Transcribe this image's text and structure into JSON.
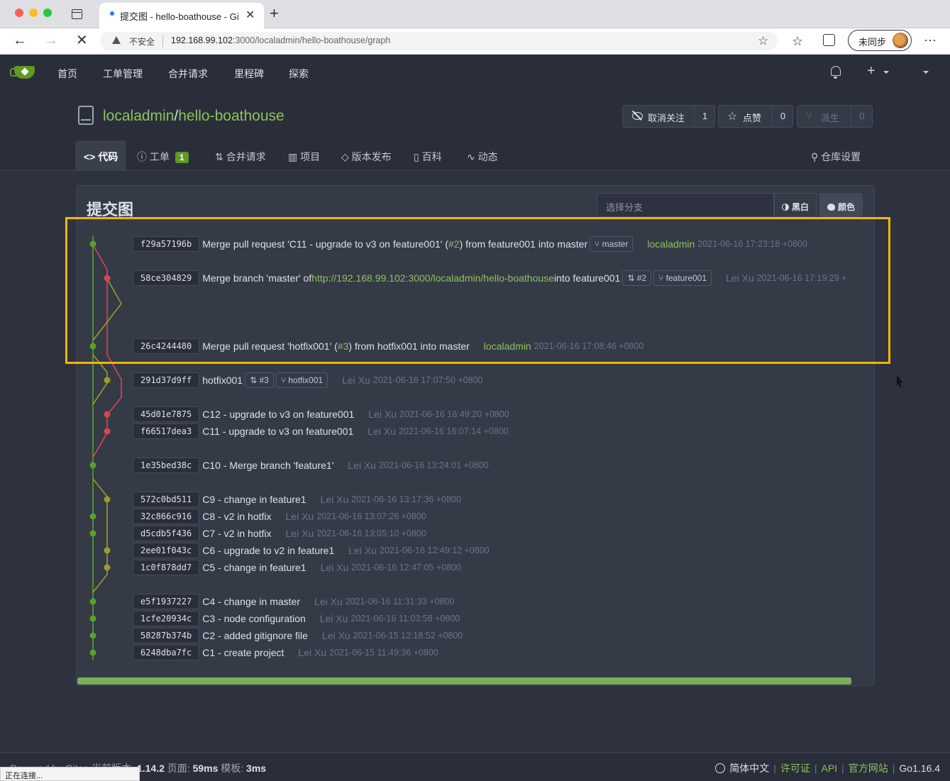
{
  "browser": {
    "tab_title": "提交图 - hello-boathouse - Gitea",
    "insecure_label": "不安全",
    "url_host": "192.168.99.102",
    "url_rest": ":3000/localadmin/hello-boathouse/graph",
    "profile_label": "未同步",
    "status_text": "正在连接..."
  },
  "nav": {
    "items": [
      "首页",
      "工单管理",
      "合并请求",
      "里程碑",
      "探索"
    ]
  },
  "repo": {
    "owner": "localadmin",
    "separator": "/",
    "name": "hello-boathouse",
    "watch_label": "取消关注",
    "watch_count": "1",
    "star_label": "点赞",
    "star_count": "0",
    "fork_label": "派生",
    "fork_count": "0",
    "tabs": {
      "code": "代码",
      "issues": "工单",
      "issues_count": "1",
      "pulls": "合并请求",
      "projects": "项目",
      "releases": "版本发布",
      "wiki": "百科",
      "activity": "动态",
      "settings": "仓库设置"
    }
  },
  "graph": {
    "title": "提交图",
    "branch_placeholder": "选择分支",
    "mode_mono": "黑白",
    "mode_color": "颜色",
    "commits": [
      {
        "sha": "f29a57196b",
        "message": "Merge pull request 'C11 - upgrade to v3 on feature001' (",
        "link": "#2",
        "message_tail": ") from feature001 into master",
        "refs": [
          "master"
        ],
        "author": "localadmin",
        "date": "2021-06-16 17:23:18 +0800"
      },
      {
        "sha": "58ce304829",
        "message": "Merge branch 'master' of",
        "link": "http://192.168.99.102:3000/localadmin/hello-boathouse",
        "message_tail": "into feature001",
        "refs": [
          "#2",
          "feature001"
        ],
        "author": "Lei Xu",
        "date": "2021-06-16 17:19:29 +"
      },
      {
        "sha": "26c4244480",
        "message": "Merge pull request 'hotfix001' (",
        "link": "#3",
        "message_tail": ") from hotfix001 into master",
        "refs": [],
        "author": "localadmin",
        "date": "2021-06-16 17:08:46 +0800"
      },
      {
        "sha": "291d37d9ff",
        "message": "hotfix001",
        "refs": [
          "#3",
          "hotfix001"
        ],
        "author": "Lei Xu",
        "date": "2021-06-16 17:07:50 +0800"
      },
      {
        "sha": "45d01e7875",
        "message": "C12 - upgrade to v3 on feature001",
        "refs": [],
        "author": "Lei Xu",
        "date": "2021-06-16 16:49:20 +0800"
      },
      {
        "sha": "f66517dea3",
        "message": "C11 - upgrade to v3 on feature001",
        "refs": [],
        "author": "Lei Xu",
        "date": "2021-06-16 16:07:14 +0800"
      },
      {
        "sha": "1e35bed38c",
        "message": "C10 - Merge branch 'feature1'",
        "refs": [],
        "author": "Lei Xu",
        "date": "2021-06-16 13:24:01 +0800"
      },
      {
        "sha": "572c0bd511",
        "message": "C9 - change in feature1",
        "refs": [],
        "author": "Lei Xu",
        "date": "2021-06-16 13:17:36 +0800"
      },
      {
        "sha": "32c866c916",
        "message": "C8 - v2 in hotfix",
        "refs": [],
        "author": "Lei Xu",
        "date": "2021-06-16 13:07:26 +0800"
      },
      {
        "sha": "d5cdb5f436",
        "message": "C7 - v2 in hotfix",
        "refs": [],
        "author": "Lei Xu",
        "date": "2021-06-16 13:05:10 +0800"
      },
      {
        "sha": "2ee01f043c",
        "message": "C6 - upgrade to v2 in feature1",
        "refs": [],
        "author": "Lei Xu",
        "date": "2021-06-16 12:49:12 +0800"
      },
      {
        "sha": "1c0f878dd7",
        "message": "C5 - change in feature1",
        "refs": [],
        "author": "Lei Xu",
        "date": "2021-06-16 12:47:05 +0800"
      },
      {
        "sha": "e5f1937227",
        "message": "C4 - change in master",
        "refs": [],
        "author": "Lei Xu",
        "date": "2021-06-16 11:31:33 +0800"
      },
      {
        "sha": "1cfe20934c",
        "message": "C3 - node configuration",
        "refs": [],
        "author": "Lei Xu",
        "date": "2021-06-16 11:03:58 +0800"
      },
      {
        "sha": "58287b374b",
        "message": "C2 - added gitignore file",
        "refs": [],
        "author": "Lei Xu",
        "date": "2021-06-15 12:18:52 +0800"
      },
      {
        "sha": "6248dba7fc",
        "message": "C1 - create project",
        "refs": [],
        "author": "Lei Xu",
        "date": "2021-06-15 11:49:36 +0800"
      }
    ]
  },
  "footer": {
    "powered": "Powered by Gitea 当前版本: ",
    "version": "1.14.2",
    "page_label": " 页面: ",
    "page_time": "59ms",
    "tpl_label": " 模板: ",
    "tpl_time": "3ms",
    "language": "简体中文",
    "license": "许可证",
    "api": "API",
    "website": "官方网站",
    "go_version": "Go1.16.4"
  },
  "colors": {
    "accent_green": "#8dc25a",
    "lane_green": "#5aa02c",
    "lane_red": "#d9454f",
    "lane_olive": "#9e9a28",
    "highlight": "#f5b600"
  }
}
